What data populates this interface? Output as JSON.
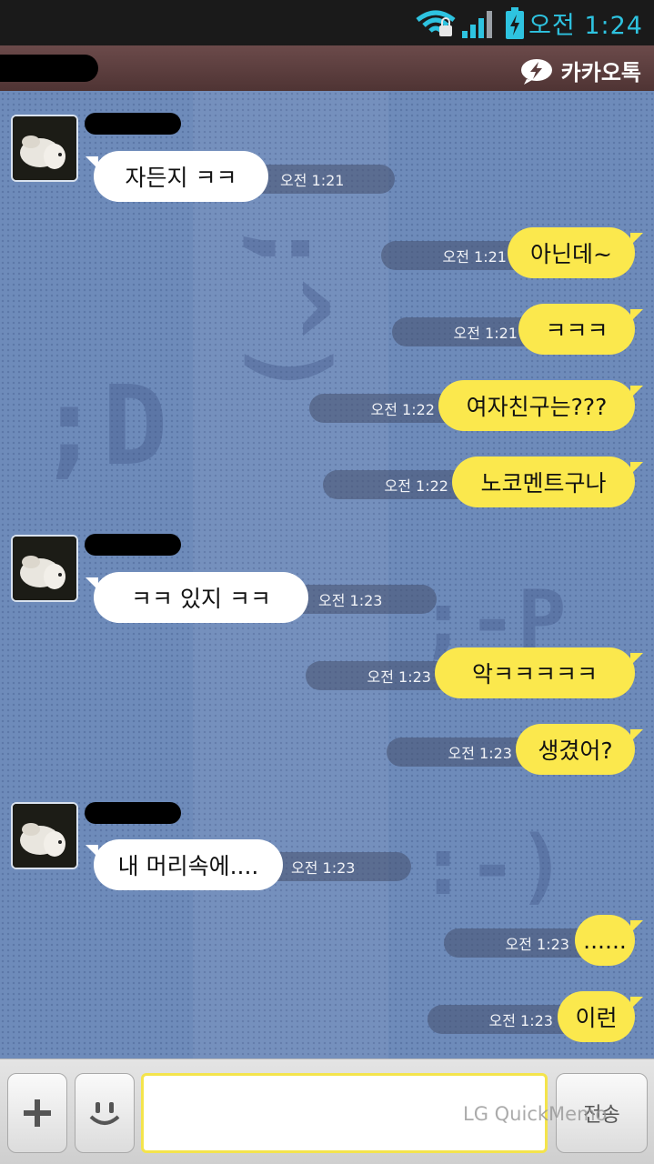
{
  "status_bar": {
    "time": "오전 1:24"
  },
  "title_bar": {
    "app_name": "카카오톡"
  },
  "messages": [
    {
      "side": "in",
      "text": "자든지 ㅋㅋ",
      "time": "오전 1:21"
    },
    {
      "side": "out",
      "text": "아닌데~",
      "time": "오전 1:21"
    },
    {
      "side": "out",
      "text": "ㅋㅋㅋ",
      "time": "오전 1:21"
    },
    {
      "side": "out",
      "text": "여자친구는???",
      "time": "오전 1:22"
    },
    {
      "side": "out",
      "text": "노코멘트구나",
      "time": "오전 1:22"
    },
    {
      "side": "in",
      "text": "ㅋㅋ 있지 ㅋㅋ",
      "time": "오전 1:23"
    },
    {
      "side": "out",
      "text": "악ㅋㅋㅋㅋㅋ",
      "time": "오전 1:23"
    },
    {
      "side": "out",
      "text": "생겼어?",
      "time": "오전 1:23"
    },
    {
      "side": "in",
      "text": "내 머리속에....",
      "time": "오전 1:23"
    },
    {
      "side": "out",
      "text": "......",
      "time": "오전 1:23"
    },
    {
      "side": "out",
      "text": "이런",
      "time": "오전 1:23"
    }
  ],
  "background_emoticons": [
    ";^)",
    ";D",
    ";-P",
    ":-)"
  ],
  "input_bar": {
    "add_label": "+",
    "send_label": "전송",
    "input_value": ""
  },
  "watermark": "LG QuickMemo",
  "colors": {
    "incoming_bubble": "#ffffff",
    "outgoing_bubble": "#fbe84d",
    "chat_background": "#6e8bba",
    "title_bar": "#5a3c3c"
  }
}
